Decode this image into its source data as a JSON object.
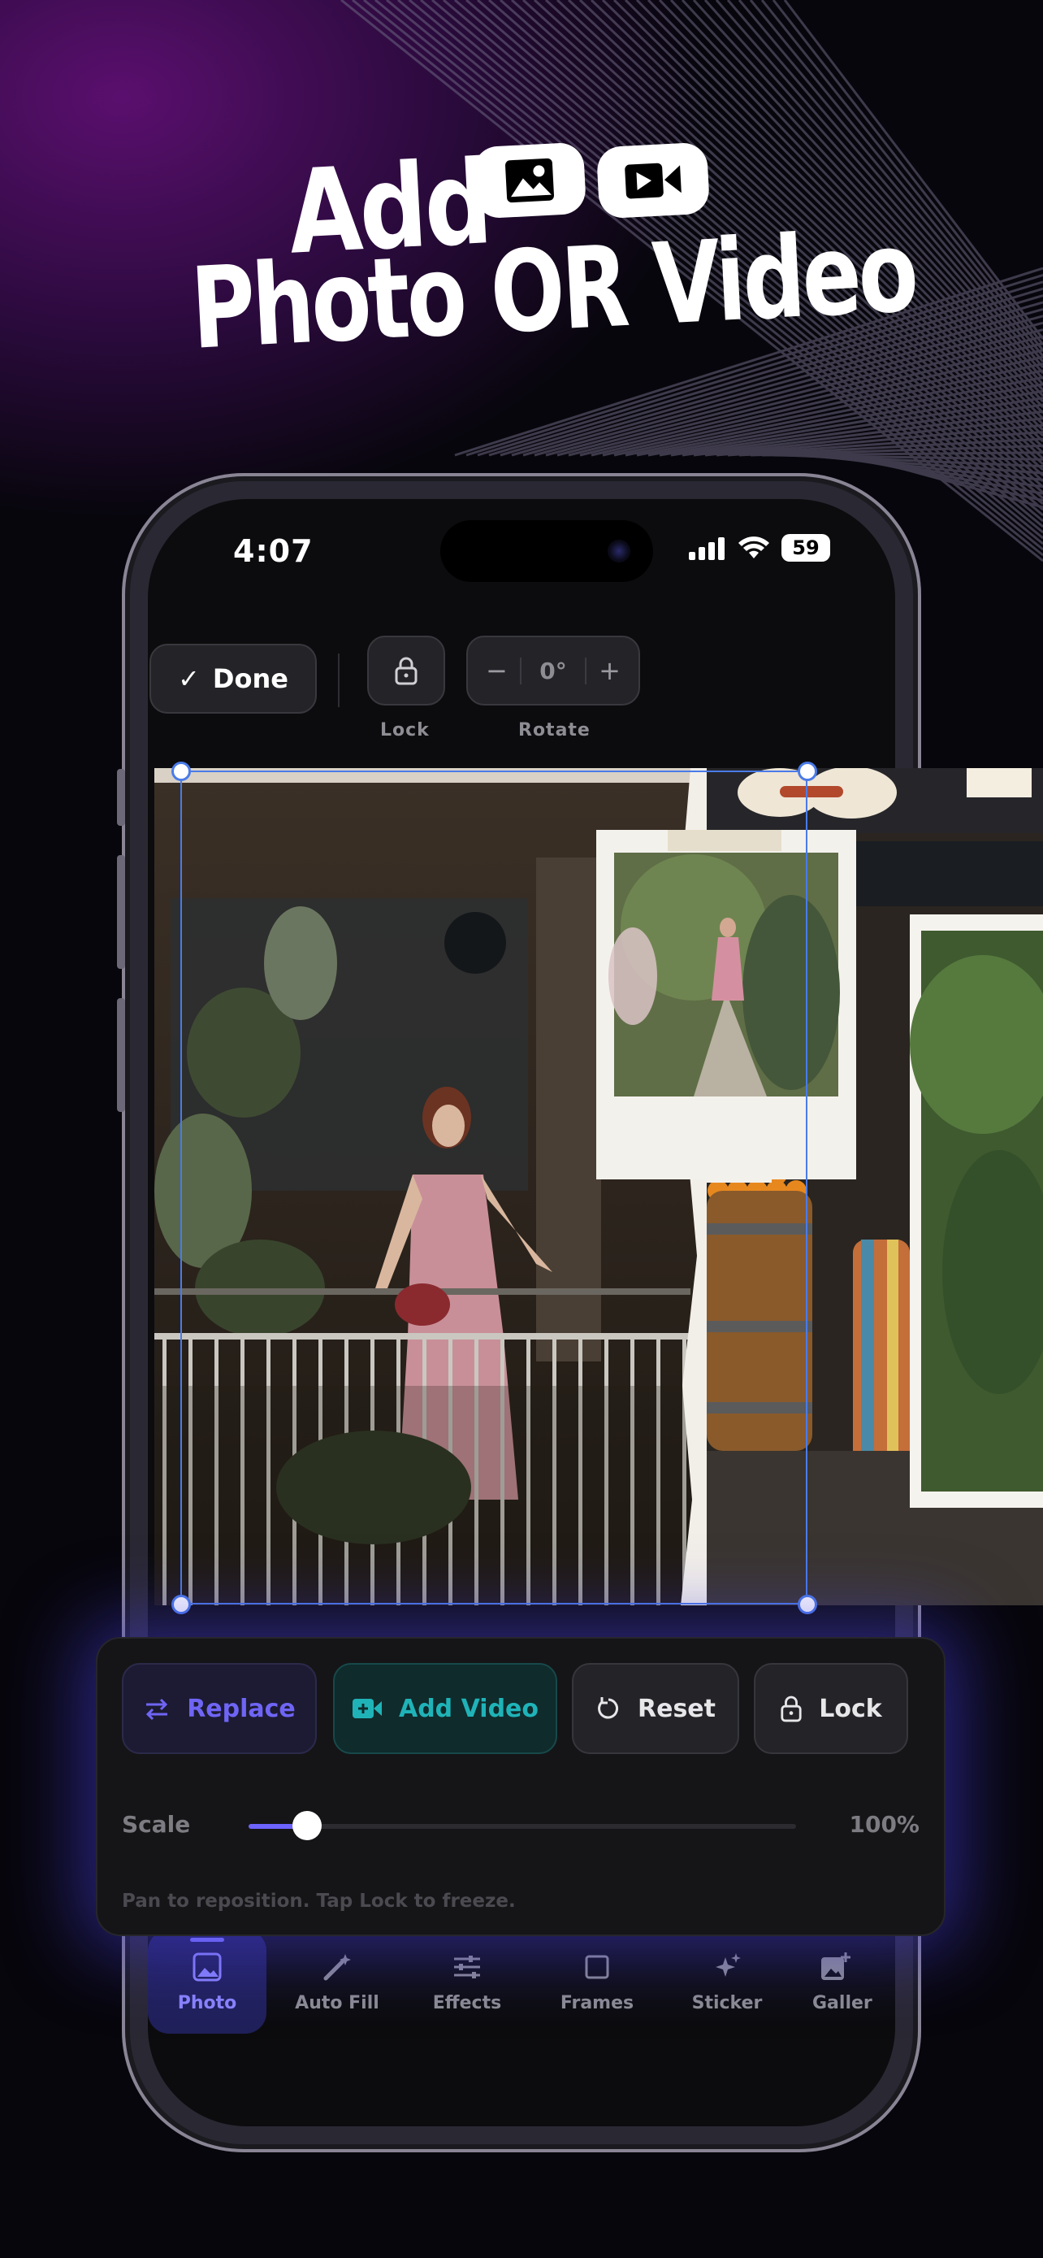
{
  "headline": {
    "line1": "Add",
    "line2": "Photo OR Video",
    "badges": [
      {
        "icon": "image-icon"
      },
      {
        "icon": "video-camera-icon"
      }
    ]
  },
  "status_bar": {
    "time": "4:07",
    "battery": "59"
  },
  "top_toolbar": {
    "done_label": "Done",
    "lock_label": "Lock",
    "rotate_label": "Rotate",
    "rotate_value": "0°",
    "minus": "−",
    "plus": "+"
  },
  "edit_panel": {
    "replace_label": "Replace",
    "add_video_label": "Add Video",
    "reset_label": "Reset",
    "lock_label": "Lock",
    "scale_label": "Scale",
    "scale_value": "100%",
    "scale_fraction": 0.08,
    "hint": "Pan to reposition. Tap Lock to freeze."
  },
  "tabs": [
    {
      "label": "Photo",
      "icon": "image-icon",
      "active": true
    },
    {
      "label": "Auto Fill",
      "icon": "magic-wand-icon",
      "active": false
    },
    {
      "label": "Effects",
      "icon": "sliders-icon",
      "active": false
    },
    {
      "label": "Frames",
      "icon": "square-icon",
      "active": false
    },
    {
      "label": "Sticker",
      "icon": "sparkles-icon",
      "active": false
    },
    {
      "label": "Galler",
      "icon": "add-image-icon",
      "active": false
    }
  ],
  "colors": {
    "accent": "#6d63ff",
    "add_video": "#1fb3b8",
    "selection": "#4a7be8"
  }
}
